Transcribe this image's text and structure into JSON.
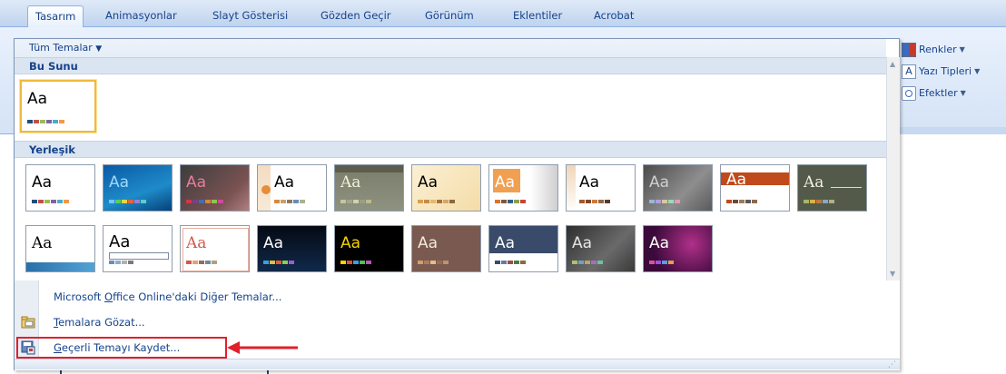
{
  "tabs": [
    "Tasarım",
    "Animasyonlar",
    "Slayt Gösterisi",
    "Gözden Geçir",
    "Görünüm",
    "Eklentiler",
    "Acrobat"
  ],
  "active_tab": "Tasarım",
  "right_commands": {
    "colors": "Renkler",
    "fonts": "Yazı Tipleri",
    "effects": "Efektler"
  },
  "gallery": {
    "all_themes_label": "Tüm Temalar",
    "section_current": "Bu Sunu",
    "section_builtin": "Yerleşik",
    "thumb_text": "Aa"
  },
  "menu": {
    "online_prefix": "Microsoft ",
    "online_underlined": "O",
    "online_suffix": "ffice Online'daki Diğer Temalar...",
    "browse_underlined": "T",
    "browse_rest": "emalara Gözat...",
    "save_underlined": "G",
    "save_rest": "eçerli Temayı Kaydet..."
  },
  "colors": {
    "highlight": "#e0202b",
    "selected_border": "#f0b93b",
    "ribbon_text": "#15428b"
  }
}
